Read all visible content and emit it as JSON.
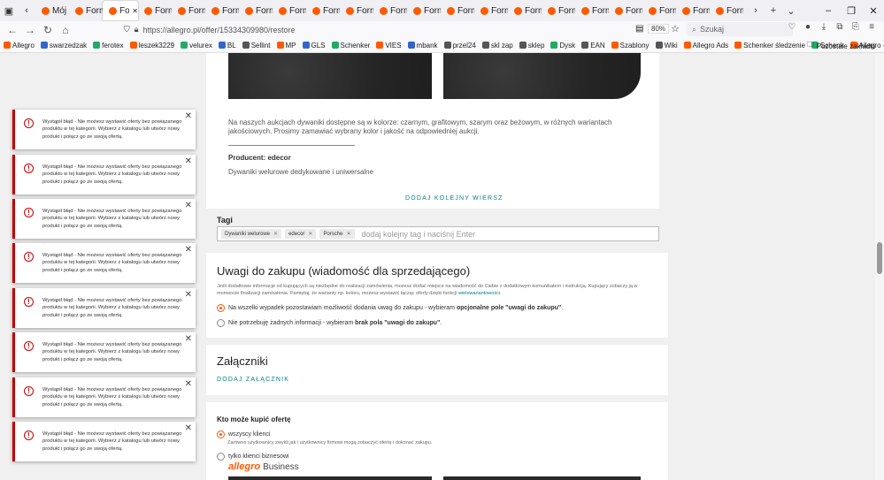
{
  "browser": {
    "tabs": [
      {
        "label": "Mój a",
        "active": false
      },
      {
        "label": "Form",
        "active": false
      },
      {
        "label": "Fo",
        "active": true
      },
      {
        "label": "Form",
        "active": false
      },
      {
        "label": "Form",
        "active": false
      },
      {
        "label": "Form",
        "active": false
      },
      {
        "label": "Form",
        "active": false
      },
      {
        "label": "Form",
        "active": false
      },
      {
        "label": "Form",
        "active": false
      },
      {
        "label": "Form",
        "active": false
      },
      {
        "label": "Form",
        "active": false
      },
      {
        "label": "Form",
        "active": false
      },
      {
        "label": "Form",
        "active": false
      },
      {
        "label": "Form",
        "active": false
      },
      {
        "label": "Form",
        "active": false
      },
      {
        "label": "Form",
        "active": false
      },
      {
        "label": "Form",
        "active": false
      },
      {
        "label": "Form",
        "active": false
      },
      {
        "label": "Form",
        "active": false
      },
      {
        "label": "Form",
        "active": false
      },
      {
        "label": "Form",
        "active": false
      }
    ],
    "url": "https://allegro.pl/offer/15334309980/restore",
    "zoom": "80%",
    "search_placeholder": "Szukaj",
    "bookmarks": [
      "Allegro",
      "swarzedzak",
      "ferotex",
      "leszek3229",
      "velurex",
      "BL",
      "Sellint",
      "MP",
      "GLS",
      "Schenker",
      "VIES",
      "mbank",
      "przel24",
      "skl zap",
      "sklep",
      "Dysk",
      "EAN",
      "Szablony",
      "Wiki",
      "Allegro Ads",
      "Schenker śledzenie",
      "Schenk",
      "Allegro - dywaniki sa..."
    ],
    "other_bookmarks": "Pozostałe zakładki"
  },
  "description": {
    "paragraph": "Na naszych aukcjach dywaniki dostępne są w kolorze: czarnym, grafitowym, szarym oraz beżowym, w różnych wariantach jakościowych. Prosimy zamawiać wybrany kolor i jakość na odpowiedniej aukcji.",
    "producer": "Producent: edecor",
    "subtitle": "Dywaniki welurowe dedykowane i uniwersalne",
    "add_row": "DODAJ KOLEJNY WIERSZ"
  },
  "tags": {
    "label": "Tagi",
    "chips": [
      "Dywaniki welurowe",
      "edecor",
      "Porsche"
    ],
    "input_placeholder": "dodaj kolejny tag i naciśnij Enter"
  },
  "purchase_notes": {
    "title": "Uwagi do zakupu (wiadomość dla sprzedającego)",
    "note": "Jeśli dodatkowe informacje od kupujących są niezbędne do realizacji zamówienia, możesz dodać miejsce na wiadomość do Ciebie z dodatkowym komunikatem i instrukcją. Kupujący zobaczy ją w momencie finalizacji zamówienia. Pamiętaj, że warianty np. koloru, możesz wystawić łącząc oferty dzięki funkcji",
    "note_link": "wielowariantowości.",
    "option1_prefix": "Na wszelki wypadek pozostawiam możliwość dodania uwag do zakupu - wybieram ",
    "option1_bold": "opcjonalne pole \"uwagi do zakupu\"",
    "option1_suffix": ".",
    "option2_prefix": "Nie potrzebuję żadnych informacji - wybieram ",
    "option2_bold": "brak pola \"uwagi do zakupu\"",
    "option2_suffix": "."
  },
  "attachments": {
    "title": "Załączniki",
    "add_button": "DODAJ ZAŁĄCZNIK"
  },
  "who_can_buy": {
    "title": "Kto może kupić ofertę",
    "option1": "wszyscy klienci",
    "option1_note": "Zarówno użytkownicy zwykli jak i użytkownicy firmowi mogą zobaczyć ofertę i dokonać zakupu.",
    "option2": "tylko klienci biznesowi",
    "brand_a": "allegro",
    "brand_b": "Business"
  },
  "toasts": {
    "message": "Wystąpił błąd - Nie możesz wystawić oferty bez powiązanego produktu w tej kategorii. Wybierz z katalogu lub utwórz nowy produkt i połącz go ze swoją ofertą.",
    "count": 8
  },
  "colors": {
    "accent": "#ff5a00",
    "link": "#00808a",
    "error": "#c40000"
  }
}
